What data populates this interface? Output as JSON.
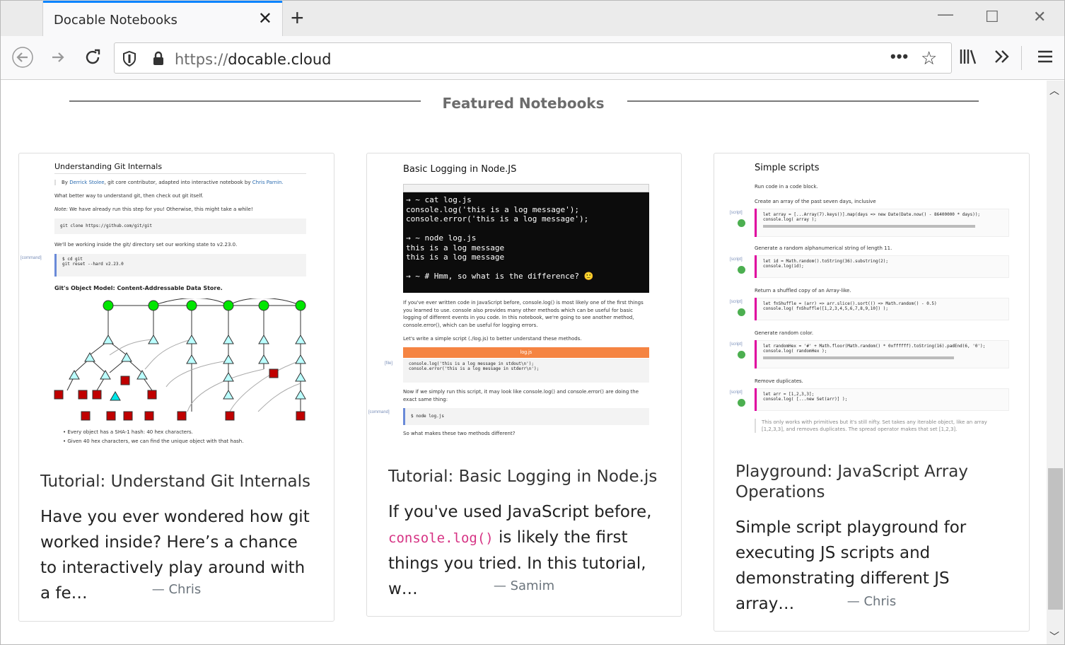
{
  "browser": {
    "tab_title": "Docable Notebooks",
    "url_protocol": "https://",
    "url_host": "docable.cloud"
  },
  "section": {
    "title": "Featured Notebooks"
  },
  "cards": [
    {
      "title": "Tutorial: Understand Git Internals",
      "desc": "Have you ever wondered how git worked inside? Here’s a chance to interactively play around with a fe…",
      "author": "— Chris",
      "thumb": {
        "heading": "Understanding Git Internals",
        "byline_prefix": "By",
        "byline_author": "Derrick Stolee",
        "byline_mid": ", git core contributor, adapted into interactive notebook by",
        "byline_adapter": "Chris Parnin.",
        "p1": "What better way to understand git, then check out git itself.",
        "p2_label": "Note:",
        "p2": "We have already run this step for you! Otherwise, this might take a while!",
        "code1": "git clone https://github.com/git/git",
        "p3": "We'll be working inside the git/ directory set our working state to v2.23.0.",
        "tag1": "[command]",
        "code2_line1": "$ cd git",
        "code2_line2": "git reset --hard v2.23.0",
        "subheading": "Git's Object Model: Content-Addressable Data Store.",
        "bullet1": "Every object has a SHA-1 hash: 40 hex characters.",
        "bullet2": "Given 40 hex characters, we can find the unique object with that hash."
      }
    },
    {
      "title": "Tutorial: Basic Logging in Node.js",
      "desc_pre": "If you've used JavaScript before, ",
      "desc_code": "console.log()",
      "desc_post": " is likely the first things you tried. In this tutorial, w…",
      "author": "— Samim",
      "thumb": {
        "heading": "Basic Logging in Node.JS",
        "term_lines": [
          "→  ~ cat log.js",
          "console.log('this is a log message');",
          "console.error('this is a log message');",
          "",
          "→  ~ node log.js",
          "this is a log message",
          "this is a log message",
          "",
          "→  ~ # Hmm, so what is the difference? 🙂"
        ],
        "p1": "If you've ever written code in JavaScript before, console.log() is most likely one of the first things you learned to use. console also provides many other methods which can be useful for basic logging of different events in you code. In this notebook, we're going to see another method, console.error(), which can be useful for logging errors.",
        "p2": "Let's write a simple script (./log.js) to better understand these methods.",
        "file_bar": "log.js",
        "tag_file": "[file]",
        "code1_line1": "console.log('this is a log message in stdout\\n');",
        "code1_line2": "console.error('this is a log message in stderr\\n');",
        "p3": "Now if we simply run this script, it may look like console.log() and console.error() are doing the exact same thing:",
        "tag_cmd": "[command]",
        "code2": "$ node log.js",
        "p4": "So what makes these two methods different?"
      }
    },
    {
      "title": "Playground: JavaScript Array Operations",
      "desc": "Simple script playground for executing JS scripts and demonstrating different JS array…",
      "author": "— Chris",
      "thumb": {
        "heading": "Simple scripts",
        "p0": "Run code in a code block.",
        "items": [
          {
            "label": "Create an array of the past seven days, inclusive",
            "code1": "let array = [...Array(7).keys()].map(days => new Date(Date.now() - 86400000 * days));",
            "code2": "console.log( array );"
          },
          {
            "label": "Generate a random alphanumerical string of length 11.",
            "code1": "let id = Math.random().toString(36).substring(2);",
            "code2": "console.log(id);"
          },
          {
            "label": "Return a shuffled copy of an Array-like.",
            "code1": "let fnShuffle = (arr) => arr.slice().sort(() => Math.random() - 0.5)",
            "code2": "console.log( fnShuffle([1,2,3,4,5,6,7,8,9,10]) );"
          },
          {
            "label": "Generate random color.",
            "code1": "let randomHex = '#' + Math.floor(Math.random() * 0xffffff).toString(16).padEnd(6, '0');",
            "code2": "console.log( randomHex );"
          },
          {
            "label": "Remove duplicates.",
            "code1": "let arr = [1,2,3,3];",
            "code2": "console.log( [...new Set(arr)] );"
          }
        ],
        "tag": "[script]",
        "note": "This only works with primitives but it's still nifty. Set takes any iterable object, like an array [1,2,3,3], and removes duplicates. The spread operator makes that set [1,2,3]."
      }
    }
  ]
}
